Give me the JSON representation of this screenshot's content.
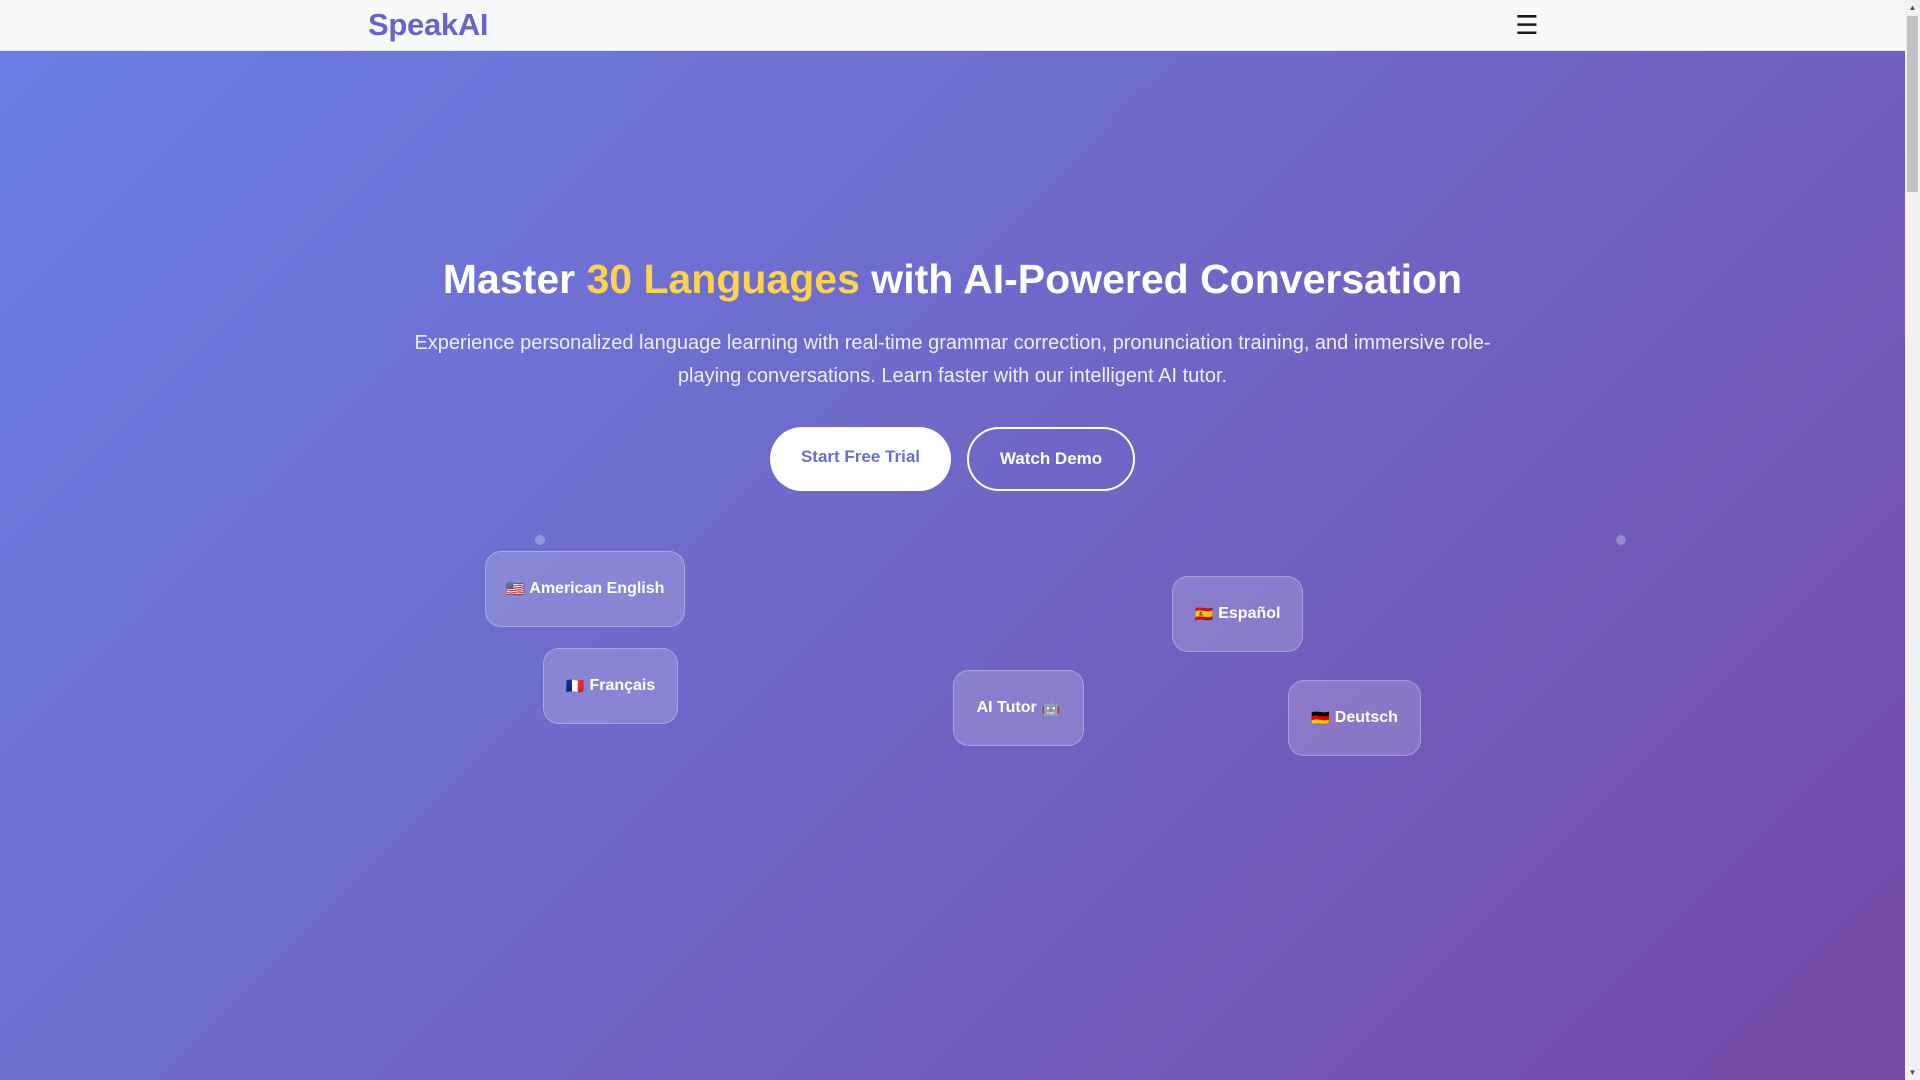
{
  "nav": {
    "logo": "SpeakAI",
    "menu_icon": "☰"
  },
  "hero": {
    "title_before": "Master ",
    "title_accent": "30 Languages",
    "title_after": " with AI-Powered Conversation",
    "subtitle": "Experience personalized language learning with real-time grammar correction, pronunciation training, and immersive role-playing conversations. Learn faster with our intelligent AI tutor.",
    "primary_button": "Start Free Trial",
    "secondary_button": "Watch Demo",
    "accent_color": "#fcd34d"
  },
  "chips": {
    "english": {
      "flag": "🇺🇸",
      "label": "American English"
    },
    "french": {
      "flag": "🇫🇷",
      "label": "Français"
    },
    "tutor": {
      "label": "AI Tutor",
      "icon": "🤖"
    },
    "spanish": {
      "flag": "🇪🇸",
      "label": "Español"
    },
    "german": {
      "flag": "🇩🇪",
      "label": "Deutsch"
    }
  },
  "scrollbar": {
    "up_arrow": "▲",
    "down_arrow": "▼"
  }
}
